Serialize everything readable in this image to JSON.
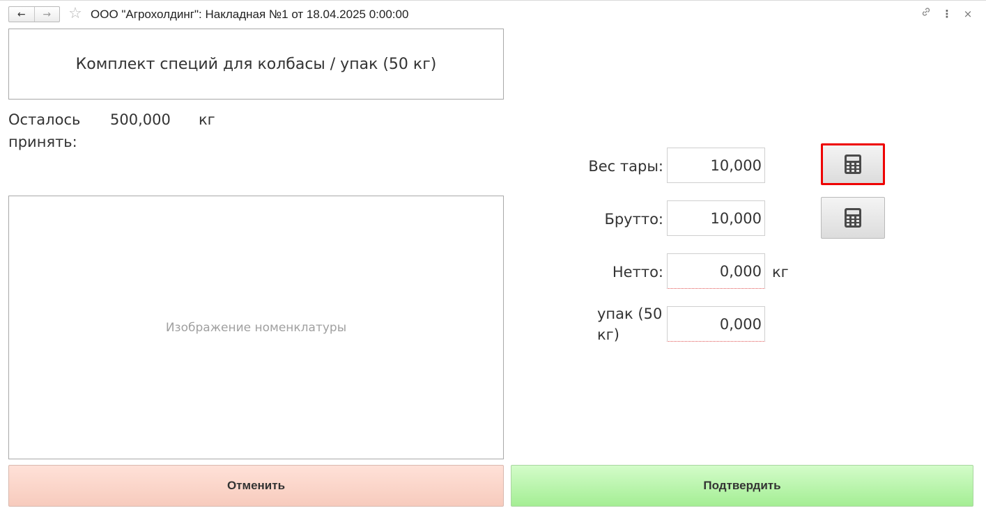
{
  "window": {
    "title": "ООО \"Агрохолдинг\": Накладная №1 от 18.04.2025 0:00:00",
    "back_icon": "←",
    "forward_icon": "→",
    "favorite_icon": "☆",
    "link_icon": "🔗",
    "more_icon": "⋮",
    "close_icon": "×"
  },
  "item": {
    "name": "Комплект специй для колбасы / упак (50 кг)",
    "remain_label": "Осталось принять:",
    "remain_value": "500,000",
    "remain_unit": "кг",
    "image_placeholder": "Изображение номенклатуры"
  },
  "fields": {
    "tare_label": "Вес тары:",
    "tare_value": "10,000",
    "gross_label": "Брутто:",
    "gross_value": "10,000",
    "net_label": "Нетто:",
    "net_value": "0,000",
    "net_unit": "кг",
    "pack_label": "упак (50 кг)",
    "pack_value": "0,000"
  },
  "buttons": {
    "cancel": "Отменить",
    "confirm": "Подтвердить"
  },
  "colors": {
    "cancel_bg": "#fbd5c9",
    "confirm_bg": "#b8f4aa",
    "highlight": "#ee0000"
  }
}
